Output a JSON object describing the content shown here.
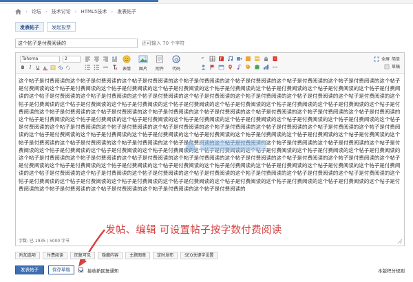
{
  "breadcrumb": {
    "items": [
      "论坛",
      "技术讨论",
      "HTML5技术",
      "发表帖子"
    ]
  },
  "tabs": [
    {
      "label": "发表帖子",
      "active": true
    },
    {
      "label": "发起投票",
      "active": false
    }
  ],
  "title_field": {
    "value": "这个帖子是付费阅读的",
    "counter": "还可输入 70 个字符"
  },
  "toolbar": {
    "font_select": "Tahoma",
    "size_select": "2",
    "big_buttons": [
      "表情",
      "图片",
      "附件",
      "代码"
    ],
    "right": {
      "full_screen": "全屏",
      "simple": "简单",
      "draft": "草稿"
    }
  },
  "editor": {
    "content": "这个帖子是付费阅读的这个帖子是付费阅读的这个帖子是付费阅读的这个帖子是付费阅读的这个帖子是付费阅读的这个帖子是付费阅读的这个帖子是付费阅读的这个帖子是付费阅读的这个帖子是付费阅读的这个帖子是付费阅读的这个帖子是付费阅读的这个帖子是付费阅读的这个帖子是付费阅读的这个帖子是付费阅读的这个帖子是付费阅读的这个帖子是付费阅读的这个帖子是付费阅读的这个帖子是付费阅读的这个帖子是付费阅读的这个帖子是付费阅读的这个帖子是付费阅读的这个帖子是付费阅读的这个帖子是付费阅读的这个帖子是付费阅读的这个帖子是付费阅读的这个帖子是付费阅读的这个帖子是付费阅读的这个帖子是付费阅读的这个帖子是付费阅读的这个帖子是付费阅读的这个帖子是付费阅读的这个帖子是付费阅读的这个帖子是付费阅读的这个帖子是付费阅读的这个帖子是付费阅读的这个帖子是付费阅读的这个帖子是付费阅读的这个帖子是付费阅读的这个帖子是付费阅读的这个帖子是付费阅读的这个帖子是付费阅读的这个帖子是付费阅读的这个帖子是付费阅读的这个帖子是付费阅读的这个帖子是付费阅读的这个帖子是付费阅读的这个帖子是付费阅读的这个帖子是付费阅读的这个帖子是付费阅读的这个帖子是付费阅读的这个帖子是付费阅读的这个帖子是付费阅读的这个帖子是付费阅读的这个帖子是付费阅读的这个帖子是付费阅读的这个帖子是付费阅读的这个帖子是付费阅读的这个帖子是付费阅读的这个帖子是付费阅读的这个帖子是付费阅读的这个帖子是付费阅读的这个帖子是付费阅读的这个帖子是付费阅读的这个帖子是付费阅读的这个帖子是付费阅读的这个帖子是付费阅读的这个帖子是付费阅读的这个帖子是付费阅读的这个帖子是付费阅读的这个帖子是付费阅读的这个帖子是付费阅读的这个帖子是付费阅读的这个帖子是付费阅读的这个帖子是付费阅读的这个帖子是付费阅读的这个帖子是付费阅读的这个帖子是付费阅读的这个帖子是付费阅读的这个帖子是付费阅读的这个帖子是付费阅读的这个帖子是付费阅读的这个帖子是付费阅读的这个帖子是付费阅读的这个帖子是付费阅读的这个帖子是付费阅读的这个帖子是付费阅读的这个帖子是付费阅读的这个帖子是付费阅读的这个帖子是付费阅读的这个帖子是付费阅读的这个帖子是付费阅读的这个帖子是付费阅读的这个帖子是付费阅读的这个帖子是付费阅读的这个帖子是付费阅读的这个帖子是付费阅读的这个帖子是付费阅读的这个帖子是付费阅读的这个帖子是付费阅读的这个帖子是付费阅读的这个帖子是付费阅读的这个帖子是付费阅读的这个帖子是付费阅读的这个帖子是付费阅读的这个帖子是付费阅读的这个帖子是付费阅读的这个帖子是付费阅读的这个帖子是付费阅读的",
    "status": "字数: 已 1935 / 5000 字节"
  },
  "annotation": "发帖、编辑 可设置帖子按字数付费阅读",
  "options": [
    "附加选项",
    "付费阅读",
    "回复可见",
    "隐藏内容",
    "主题图章",
    "定时发布",
    "SEO关键字设置"
  ],
  "submit": {
    "post_label": "发表帖子",
    "save_draft_label": "保存草稿",
    "checkbox_label": "接收新回复通知",
    "rules_link": "本版积分规则"
  },
  "colors": {
    "accent": "#3f6fb2",
    "annotation": "#d64242"
  }
}
